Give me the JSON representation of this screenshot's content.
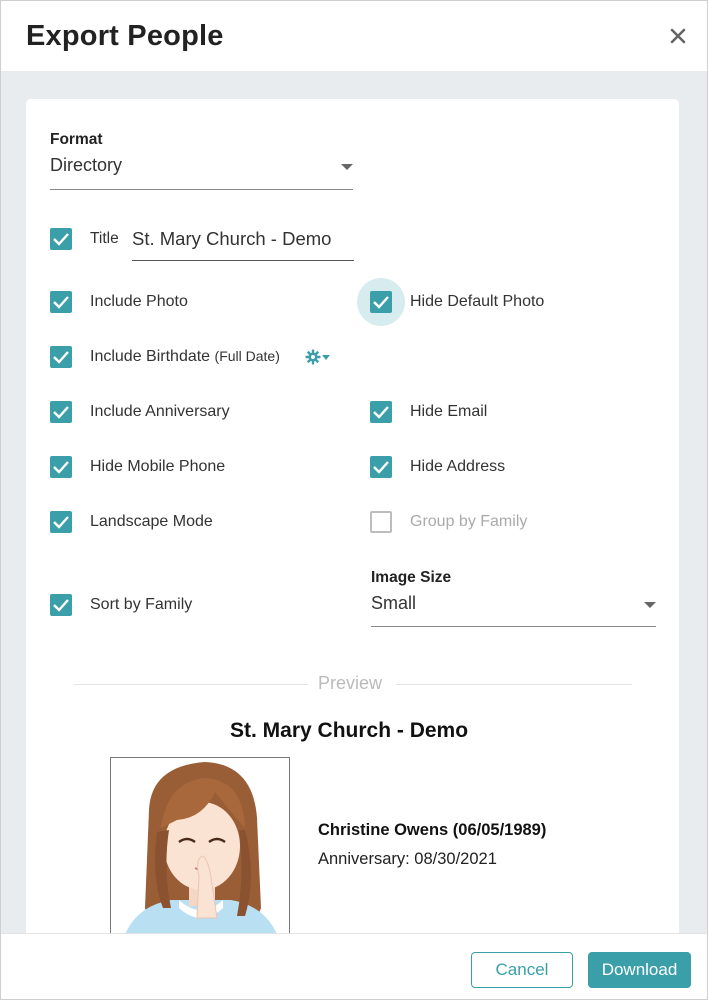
{
  "dialog": {
    "title": "Export People",
    "close_icon": "close-icon"
  },
  "format": {
    "label": "Format",
    "value": "Directory"
  },
  "title_field": {
    "checked": true,
    "label": "Title",
    "value": "St. Mary Church - Demo"
  },
  "options": {
    "include_photo": {
      "label": "Include Photo",
      "checked": true
    },
    "hide_default_photo": {
      "label": "Hide Default Photo",
      "checked": true
    },
    "include_birthdate": {
      "label": "Include Birthdate",
      "suffix": "(Full Date)",
      "checked": true,
      "settings_icon": "gear-dropdown-icon"
    },
    "include_anniversary": {
      "label": "Include Anniversary",
      "checked": true
    },
    "hide_email": {
      "label": "Hide Email",
      "checked": true
    },
    "hide_mobile_phone": {
      "label": "Hide Mobile Phone",
      "checked": true
    },
    "hide_address": {
      "label": "Hide Address",
      "checked": true
    },
    "landscape_mode": {
      "label": "Landscape Mode",
      "checked": true
    },
    "group_by_family": {
      "label": "Group by Family",
      "checked": false,
      "disabled": true
    },
    "sort_by_family": {
      "label": "Sort by Family",
      "checked": true
    }
  },
  "image_size": {
    "label": "Image Size",
    "value": "Small"
  },
  "preview": {
    "label": "Preview",
    "title": "St. Mary Church - Demo",
    "person": {
      "name": "Christine Owens (06/05/1989)",
      "anniversary": "Anniversary: 08/30/2021"
    }
  },
  "footer": {
    "cancel_label": "Cancel",
    "download_label": "Download"
  },
  "colors": {
    "accent": "#3a9fa8",
    "halo": "#d6ecee",
    "disabled": "#aaaaaa"
  }
}
